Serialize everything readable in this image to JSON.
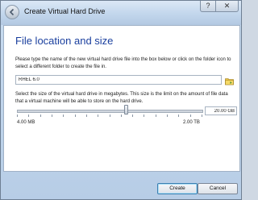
{
  "window": {
    "title": "Create Virtual Hard Drive",
    "help_label": "?",
    "close_label": "✕"
  },
  "page": {
    "heading": "File location and size",
    "location_description": "Please type the name of the new virtual hard drive file into the box below or click on the folder icon to select a different folder to create the file in.",
    "file_name_value": "RHEL 6.0",
    "size_description": "Select the size of the virtual hard drive in megabytes. This size is the limit on the amount of file data that a virtual machine will be able to store on the hard drive.",
    "size_value": "20.00 GB",
    "size_slider_fraction": 0.59,
    "min_label": "4.00 MB",
    "max_label": "2.00 TB"
  },
  "buttons": {
    "create": "Create",
    "cancel": "Cancel"
  },
  "icons": {
    "back": "back-arrow-icon",
    "folder": "folder-icon"
  }
}
